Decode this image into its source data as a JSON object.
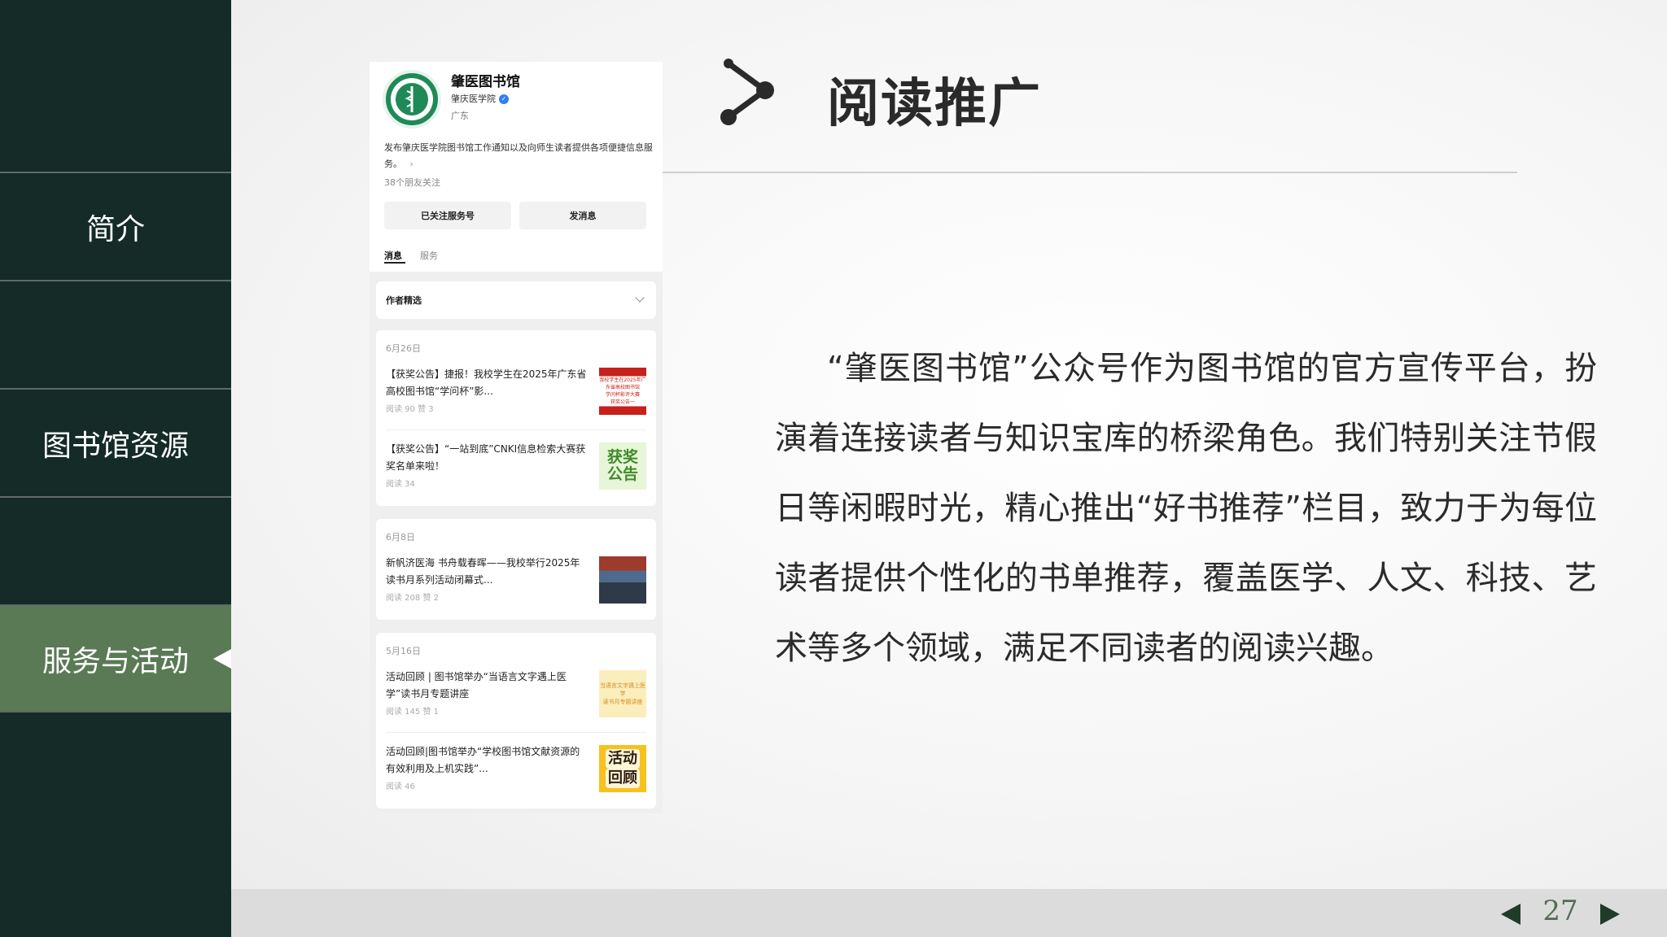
{
  "sidebar": {
    "items": [
      {
        "label": "简介"
      },
      {
        "label": ""
      },
      {
        "label": "图书馆资源"
      },
      {
        "label": ""
      },
      {
        "label": "服务与活动"
      }
    ]
  },
  "header": {
    "title": "阅读推广"
  },
  "body": {
    "paragraph": "“肇医图书馆”公众号作为图书馆的官方宣传平台，扮演着连接读者与知识宝库的桥梁角色。我们特别关注节假日等闲暇时光，精心推出“好书推荐”栏目，致力于为每位读者提供个性化的书单推荐，覆盖医学、人文、科技、艺术等多个领域，满足不同读者的阅读兴趣。"
  },
  "phone": {
    "account_name": "肇医图书馆",
    "org": "肇庆医学院",
    "region": "广东",
    "description": "发布肇庆医学院图书馆工作通知以及向师生读者提供各项便捷信息服务。",
    "desc_arrow": "›",
    "friends": "38个朋友关注",
    "follow_btn": "已关注服务号",
    "message_btn": "发消息",
    "tabs": [
      "消息",
      "服务"
    ],
    "filter_label": "作者精选",
    "groups": [
      {
        "date": "6月26日",
        "articles": [
          {
            "title": "【获奖公告】捷报！我校学生在2025年广东省高校图书馆“学问杯”影...",
            "meta": "阅读 90   赞 3",
            "thumb_lines": [
              "我校学生在2025年广",
              "东省高校图书馆",
              "学问杯影评大赛",
              "获奖公告一"
            ]
          },
          {
            "title": "【获奖公告】“一站到底”CNKI信息检索大赛获奖名单来啦！",
            "meta": "阅读 34",
            "thumb_lines": [
              "获奖",
              "公告"
            ]
          }
        ]
      },
      {
        "date": "6月8日",
        "articles": [
          {
            "title": "新帆济医海  书舟载春晖——我校举行2025年读书月系列活动闭幕式...",
            "meta": "阅读 208   赞 2",
            "thumb_lines": []
          }
        ]
      },
      {
        "date": "5月16日",
        "articles": [
          {
            "title": "活动回顾 | 图书馆举办“当语言文字遇上医学”读书月专题讲座",
            "meta": "阅读 145   赞 1",
            "thumb_lines": [
              "当语言文字遇上医学",
              "读书月专题讲座"
            ]
          },
          {
            "title": "活动回顾|图书馆举办“学校图书馆文献资源的有效利用及上机实践”...",
            "meta": "阅读 46",
            "thumb_lines": [
              "活动",
              "回顾"
            ]
          }
        ]
      }
    ]
  },
  "footer": {
    "page_number": "27"
  },
  "colors": {
    "sidebar_bg": "#142b27",
    "sidebar_active": "#5a7a55",
    "footer_bar": "#dcdcdc",
    "nav_arrow": "#1f3b2a"
  },
  "icons": {
    "title": "branch-connector-icon",
    "prev": "triangle-left-icon",
    "next": "triangle-right-icon"
  }
}
